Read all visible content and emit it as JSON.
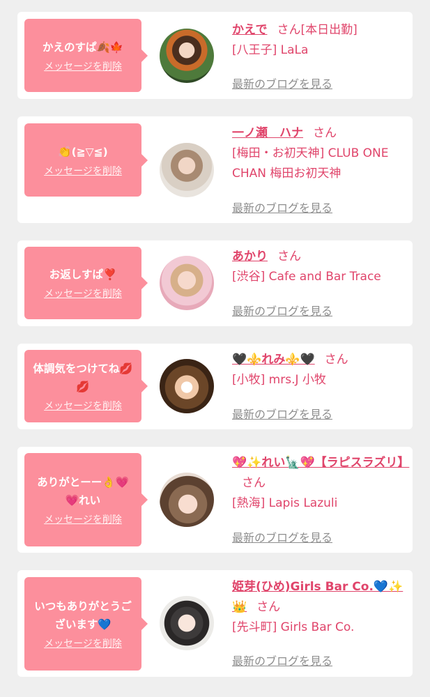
{
  "entries": [
    {
      "message": "かえのすぱ🍂🍁",
      "delete_label": "メッセージを削除",
      "name": "かえで",
      "honorific": "さん",
      "status": "[本日出勤]",
      "shop": "[八王子] LaLa",
      "blog_label": "最新のブログを見る"
    },
    {
      "message": "👏(≧▽≦)",
      "delete_label": "メッセージを削除",
      "name": "一ノ瀬　ハナ",
      "honorific": "さん",
      "status": "",
      "shop": "[梅田・お初天神] CLUB ONE CHAN 梅田お初天神",
      "blog_label": "最新のブログを見る"
    },
    {
      "message": "お返しすぱ❣️",
      "delete_label": "メッセージを削除",
      "name": "あかり",
      "honorific": "さん",
      "status": "",
      "shop": "[渋谷] Cafe and Bar Trace",
      "blog_label": "最新のブログを見る"
    },
    {
      "message": "体調気をつけてね💋💋",
      "delete_label": "メッセージを削除",
      "name": "🖤⚜️れみ⚜️🖤",
      "honorific": "さん",
      "status": "",
      "shop": "[小牧] mrs.J 小牧",
      "blog_label": "最新のブログを見る"
    },
    {
      "message": "ありがとーー👌💗💗れい",
      "delete_label": "メッセージを削除",
      "name": "💖✨れい🗽💖【ラピスラズリ】",
      "honorific": "さん",
      "status": "",
      "shop": "[熱海] Lapis Lazuli",
      "blog_label": "最新のブログを見る"
    },
    {
      "message": "いつもありがとうございます💙",
      "delete_label": "メッセージを削除",
      "name": "姫芽(ひめ)Girls Bar Co.💙✨👑",
      "honorific": "さん",
      "status": "",
      "shop": "[先斗町] Girls Bar Co.",
      "blog_label": "最新のブログを見る"
    }
  ],
  "colors": {
    "background": "#efefef",
    "card": "#ffffff",
    "bubble": "#fc8f9c",
    "accent_pink": "#e0456b",
    "link_gray": "#8e8e8e"
  }
}
